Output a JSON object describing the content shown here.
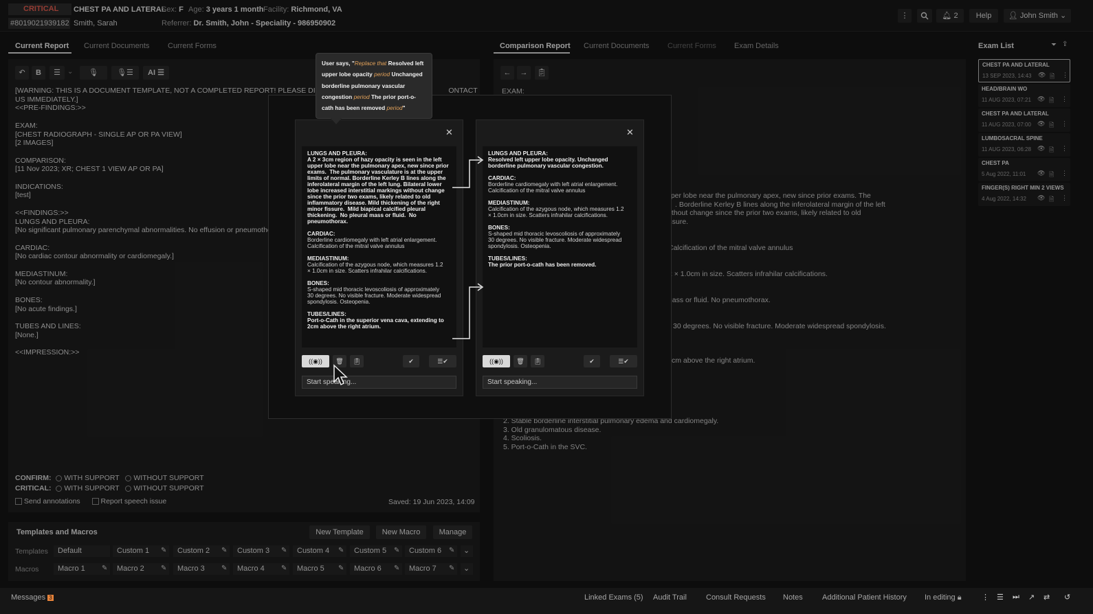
{
  "header": {
    "critical": "CRITICAL",
    "exam_title": "CHEST PA AND LATERAL",
    "sex_label": "Sex:",
    "sex": "F",
    "age_label": "Age:",
    "age": "3 years 1 month",
    "facility_label": "Facility:",
    "facility": "Richmond, VA",
    "record_id": "#8019021939182",
    "patient": "Smith, Sarah",
    "referrer_label": "Referrer:",
    "referrer": "Dr. Smith, John - Speciality - 986950902",
    "notif_count": "2",
    "help": "Help",
    "user": "John Smith"
  },
  "left_tabs": [
    "Current Report",
    "Current Documents",
    "Current Forms"
  ],
  "right_tabs": [
    "Comparison Report",
    "Current Documents",
    "Current Forms",
    "Exam Details"
  ],
  "toolbar": {
    "bold": "B",
    "ai": "AI"
  },
  "editor_text": "[WARNING: THIS IS A DOCUMENT TEMPLATE, NOT A COMPLETED REPORT! PLEASE DISREGA                                                      ONTACT\nUS IMMEDIATELY.]\n<<PRE-FINDINGS:>>\n\nEXAM:\n[CHEST RADIOGRAPH - SINGLE AP OR PA VIEW]\n[2 IMAGES]\n\nCOMPARISON:\n[11 Nov 2023; XR; CHEST 1 VIEW AP OR PA]\n\nINDICATIONS:\n[test]\n\n<<FINDINGS:>>\nLUNGS AND PLEURA:\n[No significant pulmonary parenchymal abnormalities. No effusion or pneumotho\n\nCARDIAC:\n[No cardiac contour abnormality or cardiomegaly.]\n\nMEDIASTINUM:\n[No contour abnormality.]\n\nBONES:\n[No acute findings.]\n\nTUBES AND LINES:\n[None.]\n\n<<IMPRESSION:>>",
  "confirm": {
    "confirm_label": "CONFIRM:",
    "critical_label": "CRITICAL:",
    "with": "WITH SUPPORT",
    "without": "WITHOUT SUPPORT",
    "send_annotations": "Send annotations",
    "report_speech": "Report speech issue",
    "saved": "Saved: 19 Jun 2023, 14:09"
  },
  "templates": {
    "title": "Templates and Macros",
    "new_template": "New Template",
    "new_macro": "New Macro",
    "manage": "Manage",
    "templates_label": "Templates",
    "macros_label": "Macros",
    "template_items": [
      "Default",
      "Custom 1",
      "Custom 2",
      "Custom 3",
      "Custom 4",
      "Custom 5",
      "Custom 6"
    ],
    "macro_items": [
      "Macro 1",
      "Macro 2",
      "Macro 3",
      "Macro 4",
      "Macro 5",
      "Macro 6",
      "Macro 7"
    ]
  },
  "comparison": {
    "exam_label": "EXAM:",
    "lines": [
      "pper lobe near the pulmonary apex, new since prior exams.  The",
      ". Borderline Kerley B lines along the inferolateral margin of the left",
      "gs without change since the prior two exams, likely related to old",
      "or fissure.",
      "Calcification of the mitral valve annulus",
      "2 × 1.0cm in size. Scatters infrahilar calcifications.",
      "mass or fluid.  No pneumothorax.",
      "30 degrees. No visible fracture. Moderate widespread spondylosis.",
      "cm above the right atrium."
    ],
    "impression": [
      "2. Stable borderline interstitial pulmonary edema and cardiomegaly.",
      "3. Old granulomatous disease.",
      "4. Scoliosis.",
      "5. Port-o-Cath in the SVC."
    ]
  },
  "exam_list": {
    "title": "Exam List",
    "items": [
      {
        "title": "CHEST PA AND LATERAL",
        "date": "13 SEP 2023, 14:43"
      },
      {
        "title": "HEAD/BRAIN WO",
        "date": "11 AUG 2023, 07:21"
      },
      {
        "title": "CHEST PA AND LATERAL",
        "date": "11 AUG 2023, 07:00"
      },
      {
        "title": "LUMBOSACRAL SPINE",
        "date": "11 AUG 2023, 06:28"
      },
      {
        "title": "CHEST PA",
        "date": "5 Aug 2022, 11:01"
      },
      {
        "title": "FINGER(S) RIGHT MIN 2 VIEWS",
        "date": "4 Aug 2022, 14:32"
      }
    ]
  },
  "tooltip": {
    "prefix": "User says, \"",
    "cmd1": "Replace that",
    "t1": " Resolved left upper lobe opacity ",
    "cmd2": "period",
    "t2": " Unchanged borderline pulmonary vascular congestion ",
    "cmd3": "period",
    "t3": " The prior port-o-cath has been removed ",
    "cmd4": "period",
    "suffix": "\""
  },
  "modal": {
    "left_text": [
      {
        "h": "LUNGS AND PLEURA:",
        "b": "A 2 × 3cm region of hazy opacity is seen in the left\nupper lobe near the pulmonary apex, new since prior\nexams.  The pulmonary vasculature is at the upper\nlimits of normal. Borderline Kerley B lines along the\ninferolateral margin of the left lung. Bilateral lower\nlobe increased interstitial markings without change\nsince the prior two exams, likely related to old\ninflammatory disease. Mild thickening of the right\nminor fissure.  Mild biapical calcified pleural\nthickening.  No pleural mass or fluid.  No\npneumothorax.",
        "bold": true
      },
      {
        "h": "CARDIAC:",
        "b": "Borderline cardiomegaly with left atrial enlargement.\nCalcification of the mitral valve annulus"
      },
      {
        "h": "MEDIASTINUM:",
        "b": "Calcification of the azygous node, which measures 1.2\n× 1.0cm in size. Scatters infrahilar calcifications."
      },
      {
        "h": "BONES:",
        "b": "S-shaped mid thoracic levoscoliosis of approximately\n30 degrees. No visible fracture. Moderate widespread\nspondylosis. Osteopenia."
      },
      {
        "h": "TUBES/LINES:",
        "b": "Port-o-Cath in the superior vena cava, extending to\n2cm above the right atrium.",
        "bold": true
      }
    ],
    "right_text": [
      {
        "h": "LUNGS AND PLEURA:",
        "b": "Resolved left upper lobe opacity. Unchanged\nborderline pulmonary vascular congestion.",
        "bold": true
      },
      {
        "h": "CARDIAC:",
        "b": "Borderline cardiomegaly with left atrial enlargement.\nCalcification of the mitral valve annulus"
      },
      {
        "h": "MEDIASTINUM:",
        "b": "Calcification of the azygous node, which measures 1.2\n× 1.0cm in size. Scatters infrahilar calcifications."
      },
      {
        "h": "BONES:",
        "b": "S-shaped mid thoracic levoscoliosis of approximately\n30 degrees. No visible fracture. Moderate widespread\nspondylosis. Osteopenia."
      },
      {
        "h": "TUBES/LINES:",
        "b": "The prior port-o-cath has been removed.",
        "bold": true
      }
    ],
    "placeholder": "Start speaking..."
  },
  "footer": {
    "messages": "Messages",
    "msg_count": "3",
    "linked": "Linked Exams (5)",
    "audit": "Audit Trail",
    "consult": "Consult Requests",
    "notes": "Notes",
    "history": "Additional Patient History",
    "editing": "In editing"
  }
}
